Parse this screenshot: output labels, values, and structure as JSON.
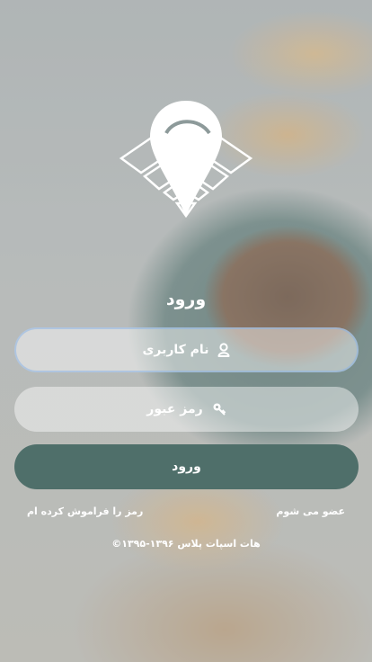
{
  "background": {
    "description_icon": "coffee-croissant-photo"
  },
  "logo": {
    "icon": "wifi-location-pin-icon"
  },
  "title": "ورود",
  "username": {
    "placeholder": "نام کاربری",
    "icon": "user-icon"
  },
  "password": {
    "placeholder": "رمز عبور",
    "icon": "key-icon"
  },
  "login_button": "ورود",
  "links": {
    "forgot": "رمز را فراموش کرده ام",
    "register": "عضو می شوم"
  },
  "copyright": "©۱۳۹۵-۱۳۹۶ هات اسپات پلاس",
  "colors": {
    "accent": "#4f6f6a",
    "text": "#ffffff"
  }
}
